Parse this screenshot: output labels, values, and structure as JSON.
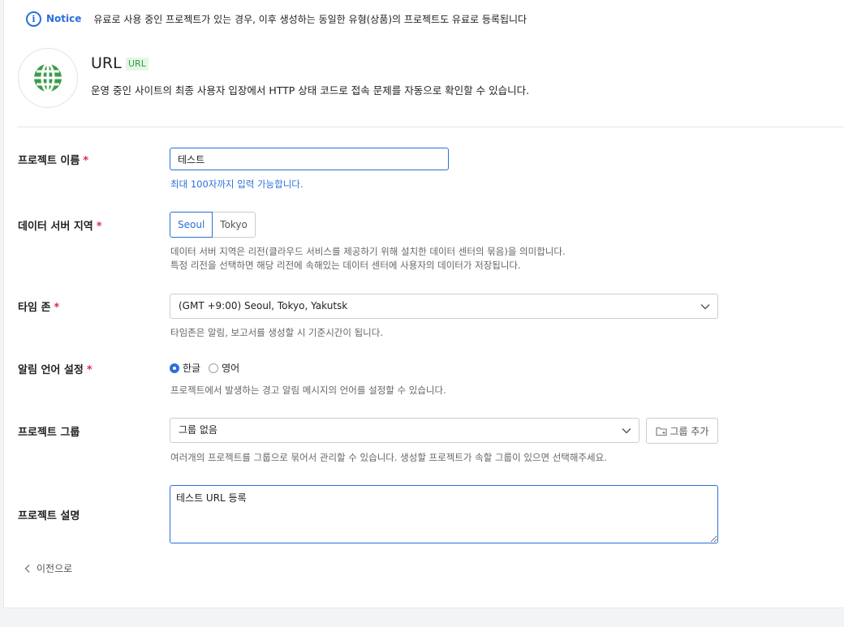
{
  "notice": {
    "title": "Notice",
    "text": "유료로 사용 중인 프로젝트가 있는 경우, 이후 생성하는 동일한 유형(상품)의 프로젝트도 유료로 등록됩니다"
  },
  "product": {
    "name": "URL",
    "badge": "URL",
    "description": "운영 중인 사이트의 최종 사용자 입장에서 HTTP 상태 코드로 접속 문제를 자동으로 확인할 수 있습니다.",
    "icon": "globe-icon",
    "accent": "#3a9d4a"
  },
  "form": {
    "project_name": {
      "label": "프로젝트 이름",
      "required_mark": "*",
      "value": "테스트",
      "help": "최대 100자까지 입력 가능합니다."
    },
    "region": {
      "label": "데이터 서버 지역",
      "required_mark": "*",
      "options": [
        "Seoul",
        "Tokyo"
      ],
      "selected": "Seoul",
      "help_line1": "데이터 서버 지역은 리전(클라우드 서비스를 제공하기 위해 설치한 데이터 센터의 묶음)을 의미합니다.",
      "help_line2": "특정 리전을 선택하면 해당 리전에 속해있는 데이터 센터에 사용자의 데이터가 저장됩니다."
    },
    "timezone": {
      "label": "타임 존",
      "required_mark": "*",
      "value": "(GMT +9:00) Seoul, Tokyo, Yakutsk",
      "help": "타임존은 알림, 보고서를 생성할 시 기준시간이 됩니다."
    },
    "language": {
      "label": "알림 언어 설정",
      "required_mark": "*",
      "options": [
        "한글",
        "영어"
      ],
      "selected": "한글",
      "help": "프로젝트에서 발생하는 경고 알림 메시지의 언어를 설정할 수 있습니다."
    },
    "group": {
      "label": "프로젝트 그룹",
      "value": "그룹 없음",
      "add_button": "그룹 추가",
      "help": "여러개의 프로젝트를 그룹으로 묶어서 관리할 수 있습니다. 생성할 프로젝트가 속할 그룹이 있으면 선택해주세요."
    },
    "description": {
      "label": "프로젝트 설명",
      "value": "테스트 URL 등록"
    }
  },
  "footer": {
    "back_label": "이전으로"
  },
  "colors": {
    "primary": "#2b6fdc",
    "required": "#d9304f"
  }
}
